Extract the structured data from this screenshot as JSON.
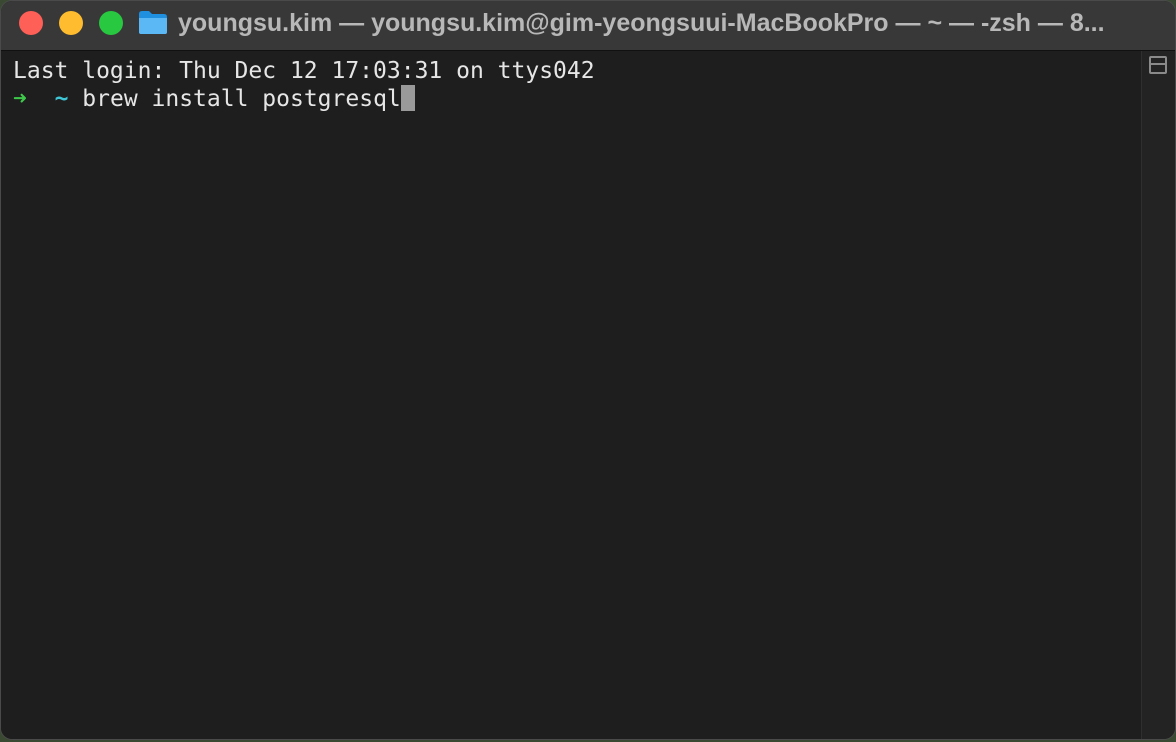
{
  "window": {
    "title": "youngsu.kim — youngsu.kim@gim-yeongsuui-MacBookPro — ~ — -zsh — 8..."
  },
  "colors": {
    "close": "#fe5f57",
    "minimize": "#febc2e",
    "zoom": "#28c840",
    "terminal_bg": "#1e1e1e",
    "prompt_arrow": "#3fc94a",
    "prompt_tilde": "#3ec6d6"
  },
  "icons": {
    "title": "folder-icon",
    "gutter": "split-pane-icon"
  },
  "terminal": {
    "last_login": "Last login: Thu Dec 12 17:03:31 on ttys042",
    "prompt_arrow": "➜",
    "prompt_dir": "~",
    "command": "brew install postgresql"
  }
}
